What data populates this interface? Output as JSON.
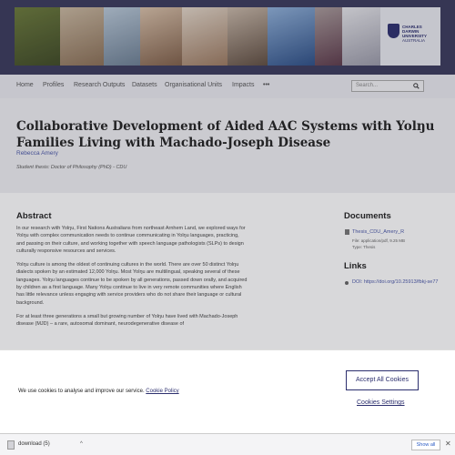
{
  "brand": {
    "lines": [
      "CHARLES",
      "DARWIN",
      "UNIVERSITY",
      "AUSTRALIA"
    ]
  },
  "nav": {
    "items": [
      "Home",
      "Profiles",
      "Research Outputs",
      "Datasets",
      "Organisational Units",
      "Impacts"
    ],
    "more": "•••",
    "search_placeholder": "Search..."
  },
  "header": {
    "title": "Collaborative Development of Aided AAC Systems with Yolŋu Families Living with Machado-Joseph Disease",
    "author": "Rebecca Amery",
    "thesis_type": "Student thesis: Doctor of Philosophy (PhD) - CDU"
  },
  "abstract": {
    "heading": "Abstract",
    "paragraphs": [
      "In our research with Yolŋu, First Nations Australians from northeast Arnhem Land, we explored ways for Yolŋu with complex communication needs to continue communicating in Yolŋu languages, practicing, and passing on their culture, and working together with speech language pathologists (SLPs) to design culturally responsive resources and services.",
      "Yolŋu culture is among the oldest of continuing cultures in the world. There are over 50 distinct Yolŋu dialects spoken by an estimated 12,000 Yolŋu. Most Yolŋu are multilingual, speaking several of these languages. Yolŋu languages continue to be spoken by all generations, passed down orally, and acquired by children as a first language. Many Yolŋu continue to live in very remote communities where English has little relevance unless engaging with service providers who do not share their language or cultural background.",
      "For at least three generations a small but growing number of Yolŋu have lived with Machado-Joseph disease (MJD) – a rare, autosomal dominant, neurodegenerative disease of"
    ]
  },
  "documents": {
    "heading": "Documents",
    "file_name": "Thesis_CDU_Amery_R",
    "file_meta": "File: application/pdf, 9.25 MB",
    "file_type": "Type: Thesis"
  },
  "links": {
    "heading": "Links",
    "url": "DOI: https://doi.org/10.25913/fbkj-se77"
  },
  "cookie": {
    "text": "We use cookies to analyse and improve our service.",
    "policy_link": "Cookie Policy",
    "accept": "Accept All Cookies",
    "settings": "Cookies Settings"
  },
  "downloads": {
    "item": "download (5)",
    "chevron": "^",
    "show_all": "Show all",
    "close": "✕"
  },
  "colors": {
    "brand": "#2c2f6e",
    "link": "#4a57a8"
  }
}
